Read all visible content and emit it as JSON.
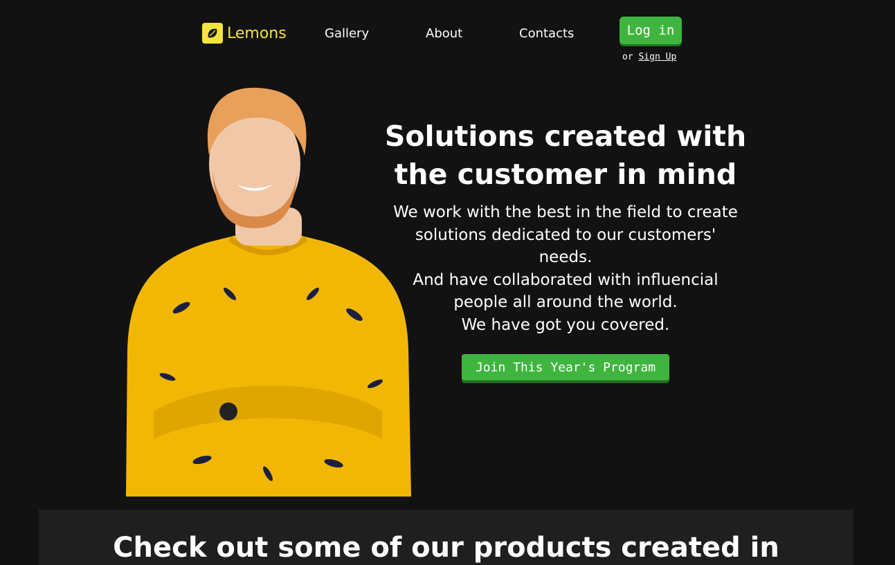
{
  "nav": {
    "logo_text": "Lemons",
    "links": [
      "Gallery",
      "About",
      "Contacts"
    ],
    "login_label": "Log in",
    "or_text": "or",
    "signup_label": "Sign Up"
  },
  "hero": {
    "title_line1": "Solutions created with",
    "title_line2": "the customer in mind",
    "desc_lines": [
      "We work with the best in the field to create",
      "solutions dedicated to our customers'",
      "needs.",
      "And have collaborated with influencial",
      "people all around the world.",
      "We have got you covered."
    ],
    "cta_label": "Join This Year's Program"
  },
  "products": {
    "title": "Check out some of our products created in"
  },
  "colors": {
    "background": "#121212",
    "accent_yellow": "#f5e43c",
    "button_green": "#3fb53f",
    "panel": "#1f1f1f"
  }
}
